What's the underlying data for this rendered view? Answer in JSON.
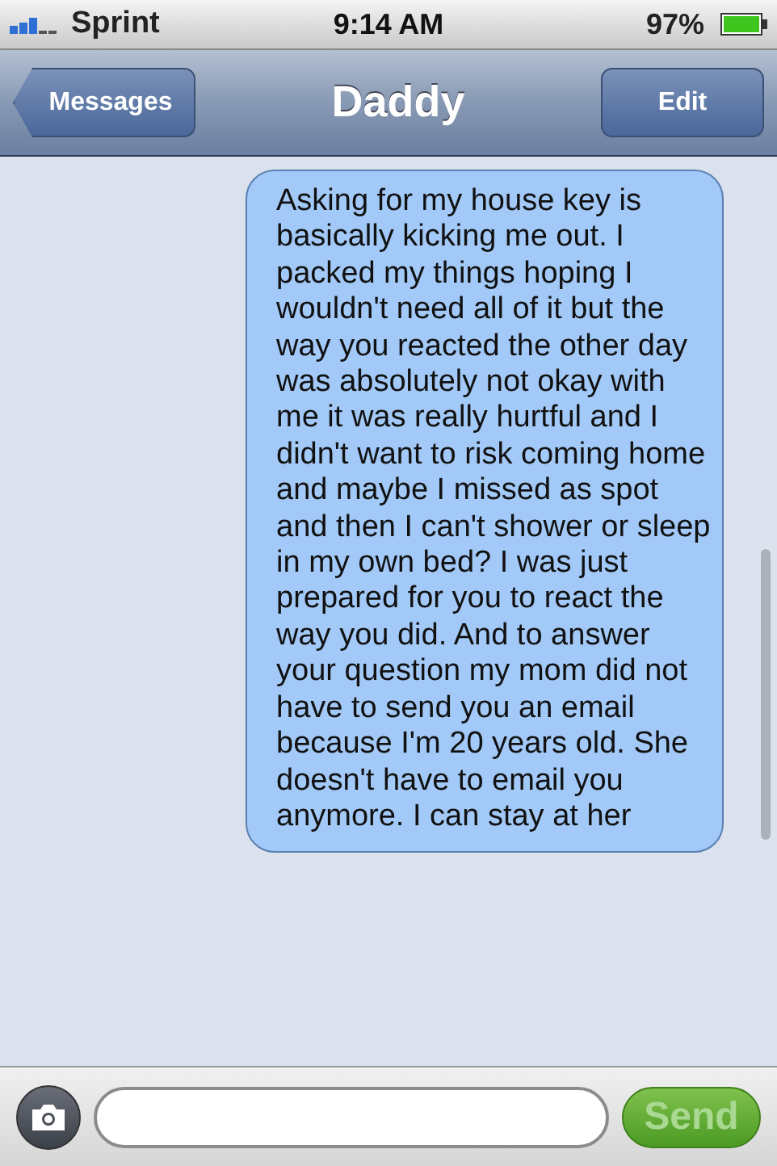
{
  "status_bar": {
    "carrier": "Sprint",
    "time": "9:14 AM",
    "battery": "97%"
  },
  "nav_bar": {
    "back": "Messages",
    "title": "Daddy",
    "edit": "Edit"
  },
  "messages": [
    {
      "kind": "sent",
      "text": "Asking for my house key is basically kicking me out. I packed my things hoping I wouldn't need all of it but the way you reacted the other day was absolutely not okay with me it was really hurtful and I didn't want to risk coming home and maybe I missed as spot and then I can't shower or sleep in my own bed? I was just prepared for you to react the way you did. And to answer your question my mom did not have to send you an email because I'm 20 years old. She doesn't have to email you anymore. I can stay at her"
    }
  ],
  "compose": {
    "send": "Send",
    "send_disabled": true
  }
}
